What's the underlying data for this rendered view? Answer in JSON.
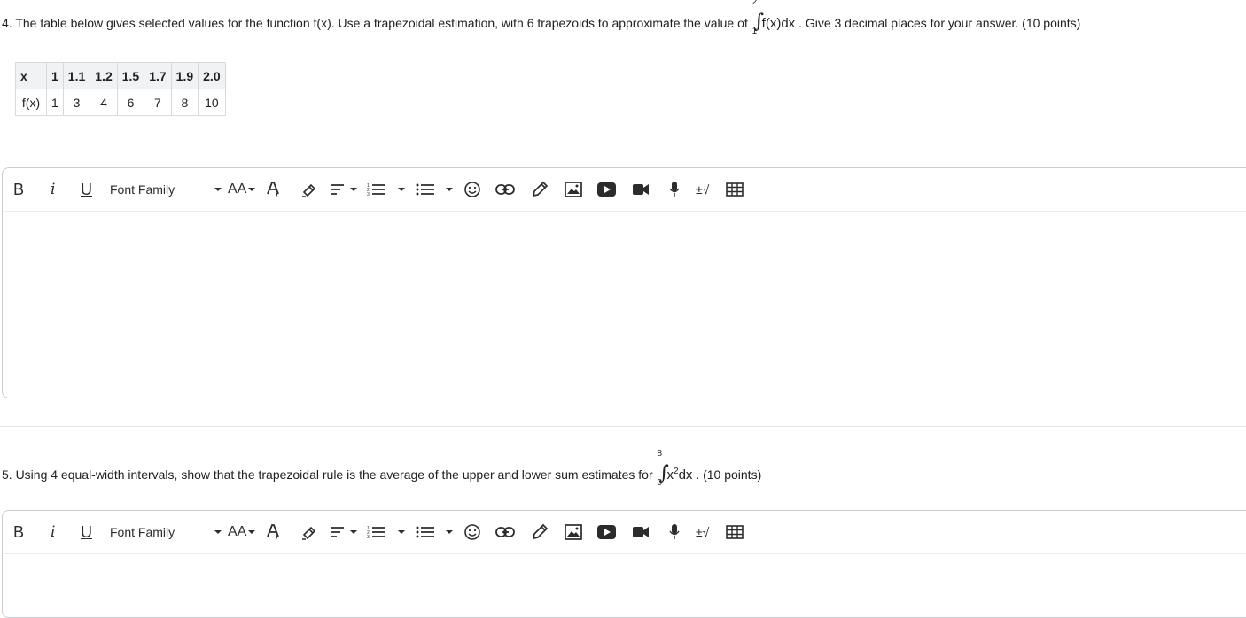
{
  "q4": {
    "text_before": "4. The table below gives selected values for the function f(x). Use a trapezoidal estimation, with 6 trapezoids to approximate the value of ",
    "integral_upper": "2",
    "integral_lower": "1",
    "integrand": "f(x)dx",
    "text_after": " . Give 3 decimal places for your answer. (10 points)"
  },
  "table": {
    "header": [
      "x",
      "1",
      "1.1",
      "1.2",
      "1.5",
      "1.7",
      "1.9",
      "2.0"
    ],
    "row": [
      "f(x)",
      "1",
      "3",
      "4",
      "6",
      "7",
      "8",
      "10"
    ]
  },
  "q5": {
    "text_before": "5. Using 4 equal-width intervals, show that the trapezoidal rule is the average of the upper and lower sum estimates for ",
    "integral_upper": "8",
    "integral_lower": "0",
    "integrand_base": "x",
    "integrand_exp": "2",
    "integrand_tail": "dx",
    "text_after": " . (10 points)"
  },
  "toolbar": {
    "bold": "B",
    "italic": "i",
    "underline": "U",
    "font_family": "Font Family",
    "font_size": "AA",
    "equation": "±√"
  },
  "colors": {
    "border": "#c9ccd1",
    "text": "#202122",
    "table_header_bg": "#f1f2f4"
  }
}
